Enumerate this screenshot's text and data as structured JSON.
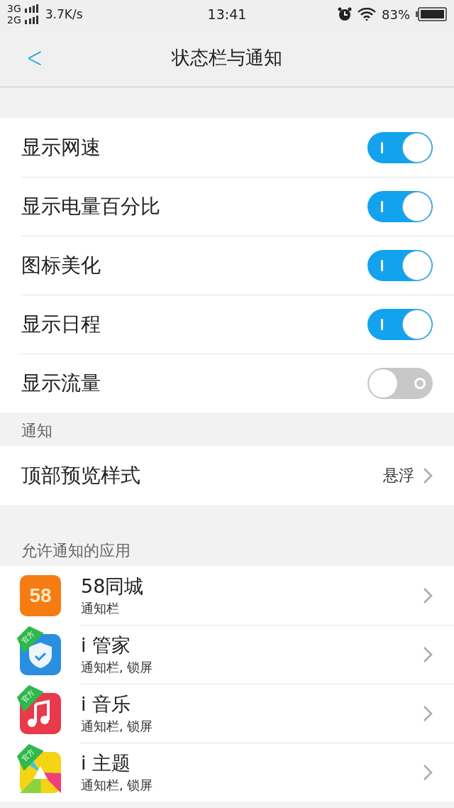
{
  "status_bar": {
    "networks": [
      {
        "label": "3G"
      },
      {
        "label": "2G"
      }
    ],
    "speed": "3.7K/s",
    "time": "13:41",
    "battery": "83%"
  },
  "header": {
    "back": "<",
    "title": "状态栏与通知"
  },
  "toggles": [
    {
      "label": "显示网速",
      "on": true
    },
    {
      "label": "显示电量百分比",
      "on": true
    },
    {
      "label": "图标美化",
      "on": true
    },
    {
      "label": "显示日程",
      "on": true
    },
    {
      "label": "显示流量",
      "on": false
    }
  ],
  "notify_section": {
    "title": "通知",
    "rows": [
      {
        "label": "顶部预览样式",
        "value": "悬浮"
      }
    ]
  },
  "apps_section": {
    "title": "允许通知的应用",
    "apps": [
      {
        "kind": "number",
        "icon_text": "58",
        "name": "58同城",
        "detail": "通知栏"
      },
      {
        "kind": "shield",
        "name": "i 管家",
        "detail": "通知栏, 锁屏",
        "badge": "官方"
      },
      {
        "kind": "note",
        "name": "i 音乐",
        "detail": "通知栏, 锁屏",
        "badge": "官方"
      },
      {
        "kind": "prism",
        "name": "i 主题",
        "detail": "通知栏, 锁屏",
        "badge": "官方"
      }
    ]
  }
}
